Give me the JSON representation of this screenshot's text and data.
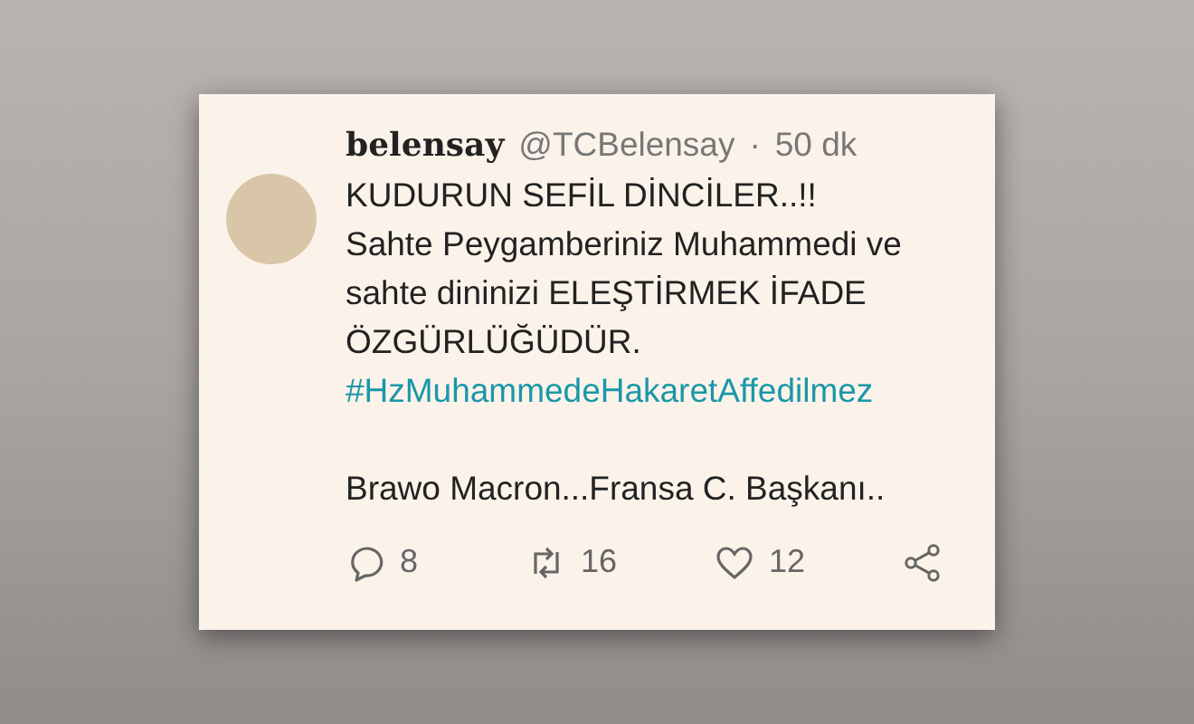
{
  "tweet": {
    "display_name": "belensay",
    "handle": "@TCBelensay",
    "separator": "·",
    "time": "50 dk",
    "body": [
      {
        "kind": "text",
        "text": "KUDURUN SEFİL DİNCİLER..!!"
      },
      {
        "kind": "text",
        "text": "Sahte Peygamberiniz Muhammedi ve"
      },
      {
        "kind": "text",
        "text": "sahte dininizi ELEŞTİRMEK İFADE"
      },
      {
        "kind": "text",
        "text": "ÖZGÜRLÜĞÜDÜR."
      },
      {
        "kind": "hashtag",
        "text": "#HzMuhammedeHakaretAffedilmez"
      },
      {
        "kind": "paragraph",
        "text": "Brawo Macron...Fransa C. Başkanı.."
      }
    ],
    "actions": [
      {
        "kind": "reply",
        "count": "8"
      },
      {
        "kind": "retweet",
        "count": "16"
      },
      {
        "kind": "like",
        "count": "12"
      },
      {
        "kind": "share"
      }
    ]
  }
}
